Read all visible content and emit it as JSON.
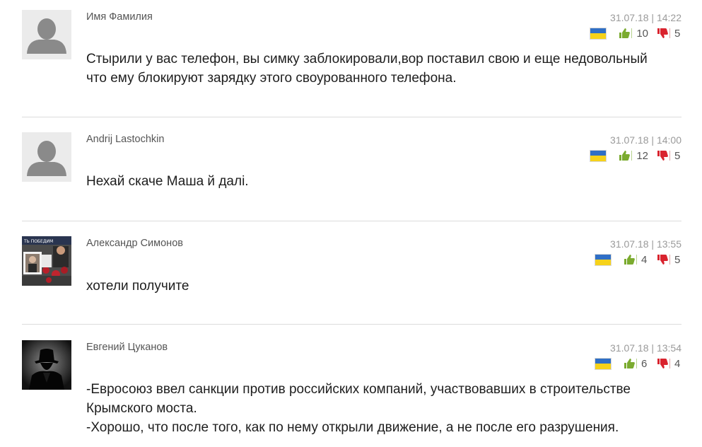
{
  "comments": [
    {
      "author": "Имя Фамилия",
      "datetime": "31.07.18 | 14:22",
      "likes": "10",
      "dislikes": "5",
      "flag": "ukraine-flag-icon",
      "avatar": "default-user-icon",
      "text_lines": [
        "Стырили у вас телефон, вы симку заблокировали,вор поставил свою и еще недовольный",
        "что ему блокируют зарядку этого своурованного телефона."
      ]
    },
    {
      "author": "Andrij Lastochkin",
      "datetime": "31.07.18 | 14:00",
      "likes": "12",
      "dislikes": "5",
      "flag": "ukraine-flag-icon",
      "avatar": "default-user-icon",
      "text_lines": [
        "Нехай скаче Маша й далі."
      ]
    },
    {
      "author": "Александр Симонов",
      "datetime": "31.07.18 | 13:55",
      "likes": "4",
      "dislikes": "5",
      "flag": "ukraine-flag-icon",
      "avatar": "photo-avatar",
      "avatar_caption": "ТЬ ПОБЕДИМ",
      "text_lines": [
        "хотели получите"
      ]
    },
    {
      "author": "Евгений Цуканов",
      "datetime": "31.07.18 | 13:54",
      "likes": "6",
      "dislikes": "4",
      "flag": "ukraine-flag-icon",
      "avatar": "hat-silhouette-avatar",
      "text_lines": [
        "-Евросоюз ввел санкции против российских компаний, участвовавших в строительстве",
        "Крымского моста.",
        "-Хорошо, что после того, как по нему открыли движение, а не после его разрушения."
      ]
    }
  ],
  "colors": {
    "flag_blue": "#2f6fc6",
    "flag_yellow": "#f6d21a",
    "like_green": "#7bab2f",
    "dislike_red": "#d9232e"
  }
}
